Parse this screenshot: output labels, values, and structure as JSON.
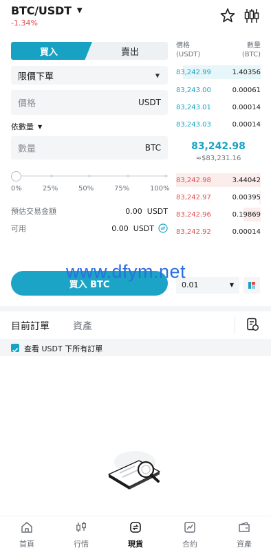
{
  "header": {
    "pair": "BTC/USDT",
    "change": "-1.34%"
  },
  "trade": {
    "tab_buy": "買入",
    "tab_sell": "賣出",
    "order_type": "限價下單",
    "price_placeholder": "價格",
    "price_unit": "USDT",
    "qty_mode": "依數量",
    "qty_placeholder": "數量",
    "qty_unit": "BTC",
    "slider_value": 0,
    "percent_marks": [
      "0%",
      "25%",
      "50%",
      "75%",
      "100%"
    ],
    "est_label": "預估交易金額",
    "est_value": "0.00",
    "est_unit": "USDT",
    "avail_label": "可用",
    "avail_value": "0.00",
    "avail_unit": "USDT",
    "buy_button": "買入 BTC"
  },
  "orderbook": {
    "price_header": [
      "價格",
      "(USDT)"
    ],
    "qty_header": [
      "數量",
      "(BTC)"
    ],
    "bids": [
      {
        "price": "83,242.99",
        "qty": "1.40356",
        "depth": 0.92
      },
      {
        "price": "83,243.00",
        "qty": "0.00061",
        "depth": 0.0
      },
      {
        "price": "83,243.01",
        "qty": "0.00014",
        "depth": 0.0
      },
      {
        "price": "83,243.03",
        "qty": "0.00014",
        "depth": 0.0
      }
    ],
    "mid_price": "83,242.98",
    "mid_fiat": "≈$83,231.16",
    "asks": [
      {
        "price": "83,242.98",
        "qty": "3.44042",
        "depth": 1.0
      },
      {
        "price": "83,242.97",
        "qty": "0.00395",
        "depth": 0.02
      },
      {
        "price": "83,242.96",
        "qty": "0.19869",
        "depth": 0.2
      },
      {
        "price": "83,242.92",
        "qty": "0.00014",
        "depth": 0.0
      }
    ],
    "depth_value": "0.01",
    "bid_color": "#17a2c4",
    "ask_color": "#e04c4c"
  },
  "watermark": "www.dfym.net",
  "orders": {
    "tab_open": "目前訂單",
    "tab_assets": "資產",
    "filter_label": "查看 USDT 下所有訂單",
    "filter_checked": true
  },
  "nav": [
    {
      "label": "首頁",
      "icon": "home-icon"
    },
    {
      "label": "行情",
      "icon": "market-icon"
    },
    {
      "label": "現貨",
      "icon": "spot-icon",
      "active": true
    },
    {
      "label": "合約",
      "icon": "futures-icon"
    },
    {
      "label": "資產",
      "icon": "wallet-icon"
    }
  ]
}
